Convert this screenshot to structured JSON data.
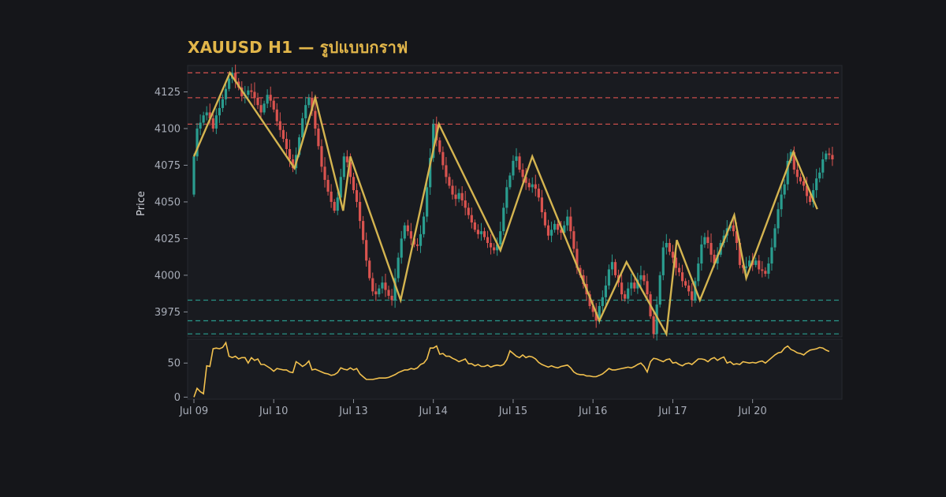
{
  "chart_data": {
    "type": "candlestick",
    "title": "XAUUSD H1 — รูปแบบกราฟ",
    "ylabel": "Price",
    "colors": {
      "background": "#15161a",
      "panel": "#191b20",
      "up": "#2a9d8f",
      "down": "#d9534f",
      "zigzag": "#d4b450",
      "indicator": "#f2c14e",
      "resistance": "#d9534f",
      "support": "#2a9d8f",
      "title": "#e2b64a"
    },
    "price_panel": {
      "ylim": [
        3958,
        4143
      ],
      "yticks": [
        3975,
        4000,
        4025,
        4050,
        4075,
        4100,
        4125
      ]
    },
    "indicator_panel": {
      "ylim": [
        -3,
        85
      ],
      "yticks": [
        0,
        50
      ]
    },
    "x_range": [
      0,
      8.08
    ],
    "x_ticks": [
      {
        "x": 0,
        "label": "Jul 09"
      },
      {
        "x": 1,
        "label": "Jul 10"
      },
      {
        "x": 2,
        "label": "Jul 13"
      },
      {
        "x": 3,
        "label": "Jul 14"
      },
      {
        "x": 4,
        "label": "Jul 15"
      },
      {
        "x": 5,
        "label": "Jul 16"
      },
      {
        "x": 6,
        "label": "Jul 17"
      },
      {
        "x": 7,
        "label": "Jul 20"
      }
    ],
    "resistance_levels": [
      4138,
      4121,
      4103
    ],
    "support_levels": [
      3983,
      3969,
      3960
    ],
    "zigzag": [
      {
        "x": 0.0,
        "y": 4081
      },
      {
        "x": 0.45,
        "y": 4138
      },
      {
        "x": 1.26,
        "y": 4073
      },
      {
        "x": 1.52,
        "y": 4121
      },
      {
        "x": 1.87,
        "y": 4044
      },
      {
        "x": 1.96,
        "y": 4081
      },
      {
        "x": 2.59,
        "y": 3983
      },
      {
        "x": 3.07,
        "y": 4103
      },
      {
        "x": 3.84,
        "y": 4017
      },
      {
        "x": 4.24,
        "y": 4081
      },
      {
        "x": 5.08,
        "y": 3969
      },
      {
        "x": 5.42,
        "y": 4009
      },
      {
        "x": 5.92,
        "y": 3960
      },
      {
        "x": 6.05,
        "y": 4024
      },
      {
        "x": 6.34,
        "y": 3983
      },
      {
        "x": 6.77,
        "y": 4041
      },
      {
        "x": 6.92,
        "y": 3998
      },
      {
        "x": 7.51,
        "y": 4084
      },
      {
        "x": 7.81,
        "y": 4045
      }
    ],
    "series": [
      {
        "type": "candlestick",
        "x_start": 0,
        "x_step": 0.04,
        "close": [
          4081,
          4100,
          4104,
          4109,
          4111,
          4107,
          4100,
          4109,
          4114,
          4120,
          4127,
          4134,
          4138,
          4132,
          4128,
          4122,
          4123,
          4126,
          4125,
          4121,
          4116,
          4111,
          4117,
          4123,
          4119,
          4113,
          4105,
          4099,
          4093,
          4086,
          4079,
          4073,
          4082,
          4094,
          4107,
          4116,
          4121,
          4112,
          4100,
          4088,
          4074,
          4065,
          4057,
          4050,
          4044,
          4053,
          4067,
          4081,
          4077,
          4067,
          4058,
          4050,
          4037,
          4024,
          4010,
          3998,
          3989,
          3987,
          3991,
          3995,
          3990,
          3986,
          3983,
          3998,
          4012,
          4025,
          4034,
          4030,
          4025,
          4021,
          4020,
          4028,
          4040,
          4060,
          4080,
          4103,
          4092,
          4084,
          4075,
          4067,
          4061,
          4055,
          4052,
          4056,
          4051,
          4046,
          4041,
          4036,
          4031,
          4028,
          4030,
          4026,
          4022,
          4019,
          4017,
          4021,
          4030,
          4046,
          4060,
          4068,
          4078,
          4081,
          4072,
          4067,
          4063,
          4060,
          4062,
          4059,
          4053,
          4043,
          4034,
          4027,
          4031,
          4035,
          4031,
          4029,
          4034,
          4040,
          4030,
          4018,
          4005,
          4000,
          3994,
          3987,
          3979,
          3975,
          3969,
          3979,
          3985,
          3993,
          4004,
          4009,
          4000,
          3995,
          3987,
          3984,
          3991,
          3995,
          3991,
          3997,
          4000,
          3996,
          3987,
          3972,
          3960,
          3980,
          4000,
          4019,
          4022,
          4016,
          4012,
          4005,
          4002,
          3996,
          3993,
          3989,
          3983,
          3996,
          4008,
          4021,
          4026,
          4022,
          4014,
          4008,
          4014,
          4022,
          4027,
          4032,
          4034,
          4030,
          4022,
          4007,
          4005,
          4006,
          4010,
          4007,
          4010,
          4004,
          4003,
          4001,
          4008,
          4019,
          4032,
          4045,
          4055,
          4062,
          4078,
          4084,
          4072,
          4067,
          4064,
          4061,
          4054,
          4050,
          4058,
          4066,
          4070,
          4079,
          4083,
          4082,
          4079
        ]
      },
      {
        "type": "line",
        "panel": "indicator",
        "values": [
          0,
          13,
          8,
          5,
          46,
          45,
          71,
          72,
          71,
          73,
          80,
          60,
          58,
          60,
          56,
          58,
          58,
          50,
          58,
          54,
          56,
          48,
          48,
          45,
          42,
          38,
          42,
          41,
          40,
          40,
          37,
          36,
          52,
          49,
          45,
          48,
          53,
          40,
          41,
          39,
          37,
          35,
          34,
          32,
          33,
          36,
          43,
          41,
          40,
          43,
          40,
          42,
          34,
          30,
          26,
          26,
          26,
          27,
          28,
          28,
          28,
          29,
          31,
          33,
          36,
          38,
          40,
          40,
          42,
          41,
          43,
          48,
          50,
          56,
          72,
          72,
          75,
          63,
          64,
          60,
          60,
          57,
          55,
          52,
          54,
          56,
          49,
          49,
          46,
          48,
          45,
          45,
          47,
          44,
          46,
          47,
          46,
          48,
          55,
          68,
          64,
          60,
          58,
          62,
          58,
          60,
          59,
          56,
          51,
          48,
          46,
          44,
          46,
          44,
          43,
          45,
          46,
          47,
          43,
          37,
          34,
          33,
          33,
          31,
          31,
          30,
          30,
          32,
          34,
          38,
          42,
          40,
          40,
          41,
          42,
          43,
          44,
          43,
          45,
          48,
          50,
          45,
          37,
          52,
          57,
          56,
          54,
          52,
          55,
          56,
          50,
          51,
          48,
          46,
          49,
          50,
          48,
          52,
          56,
          56,
          55,
          52,
          56,
          58,
          54,
          57,
          59,
          50,
          52,
          48,
          49,
          48,
          52,
          51,
          50,
          51,
          50,
          52,
          53,
          50,
          54,
          58,
          62,
          65,
          66,
          72,
          75,
          70,
          68,
          65,
          64,
          62,
          66,
          69,
          70,
          71,
          73,
          72,
          69,
          67
        ]
      }
    ]
  }
}
